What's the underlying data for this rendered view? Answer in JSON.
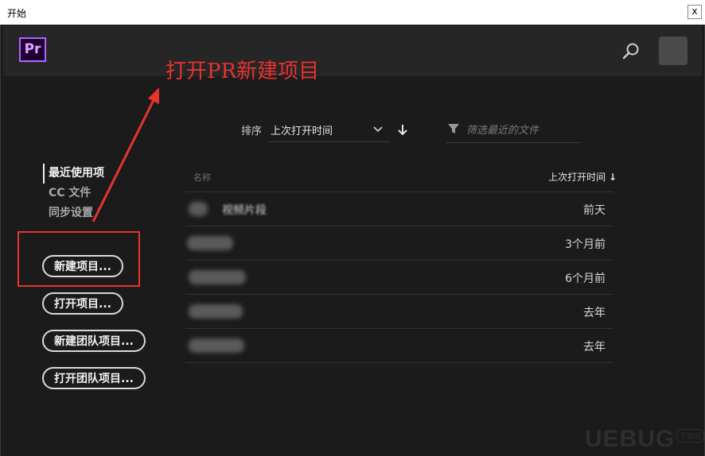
{
  "window": {
    "title": "开始",
    "close_glyph": "x"
  },
  "header": {
    "logo_text": "Pr",
    "search_icon": "search-icon",
    "avatar": "avatar"
  },
  "annotation": {
    "text": "打开PR新建项目",
    "color": "#e8322e"
  },
  "nav": {
    "items": [
      {
        "label": "最近使用项",
        "active": true
      },
      {
        "label": "CC 文件",
        "active": false
      },
      {
        "label": "同步设置",
        "active": false
      }
    ]
  },
  "buttons": {
    "new_project": "新建项目...",
    "open_project": "打开项目...",
    "new_team_project": "新建团队项目...",
    "open_team_project": "打开团队项目..."
  },
  "toolbar": {
    "sort_label": "排序",
    "sort_value": "上次打开时间",
    "filter_placeholder": "筛选最近的文件"
  },
  "table": {
    "col_name": "名称",
    "col_date": "上次打开时间",
    "rows": [
      {
        "name": "视频片段",
        "date": "前天"
      },
      {
        "name": "",
        "date": "3个月前"
      },
      {
        "name": "",
        "date": "6个月前"
      },
      {
        "name": "",
        "date": "去年"
      },
      {
        "name": "",
        "date": "去年"
      }
    ]
  },
  "watermark": {
    "text": "UEBUG",
    "badge": "下载站"
  }
}
